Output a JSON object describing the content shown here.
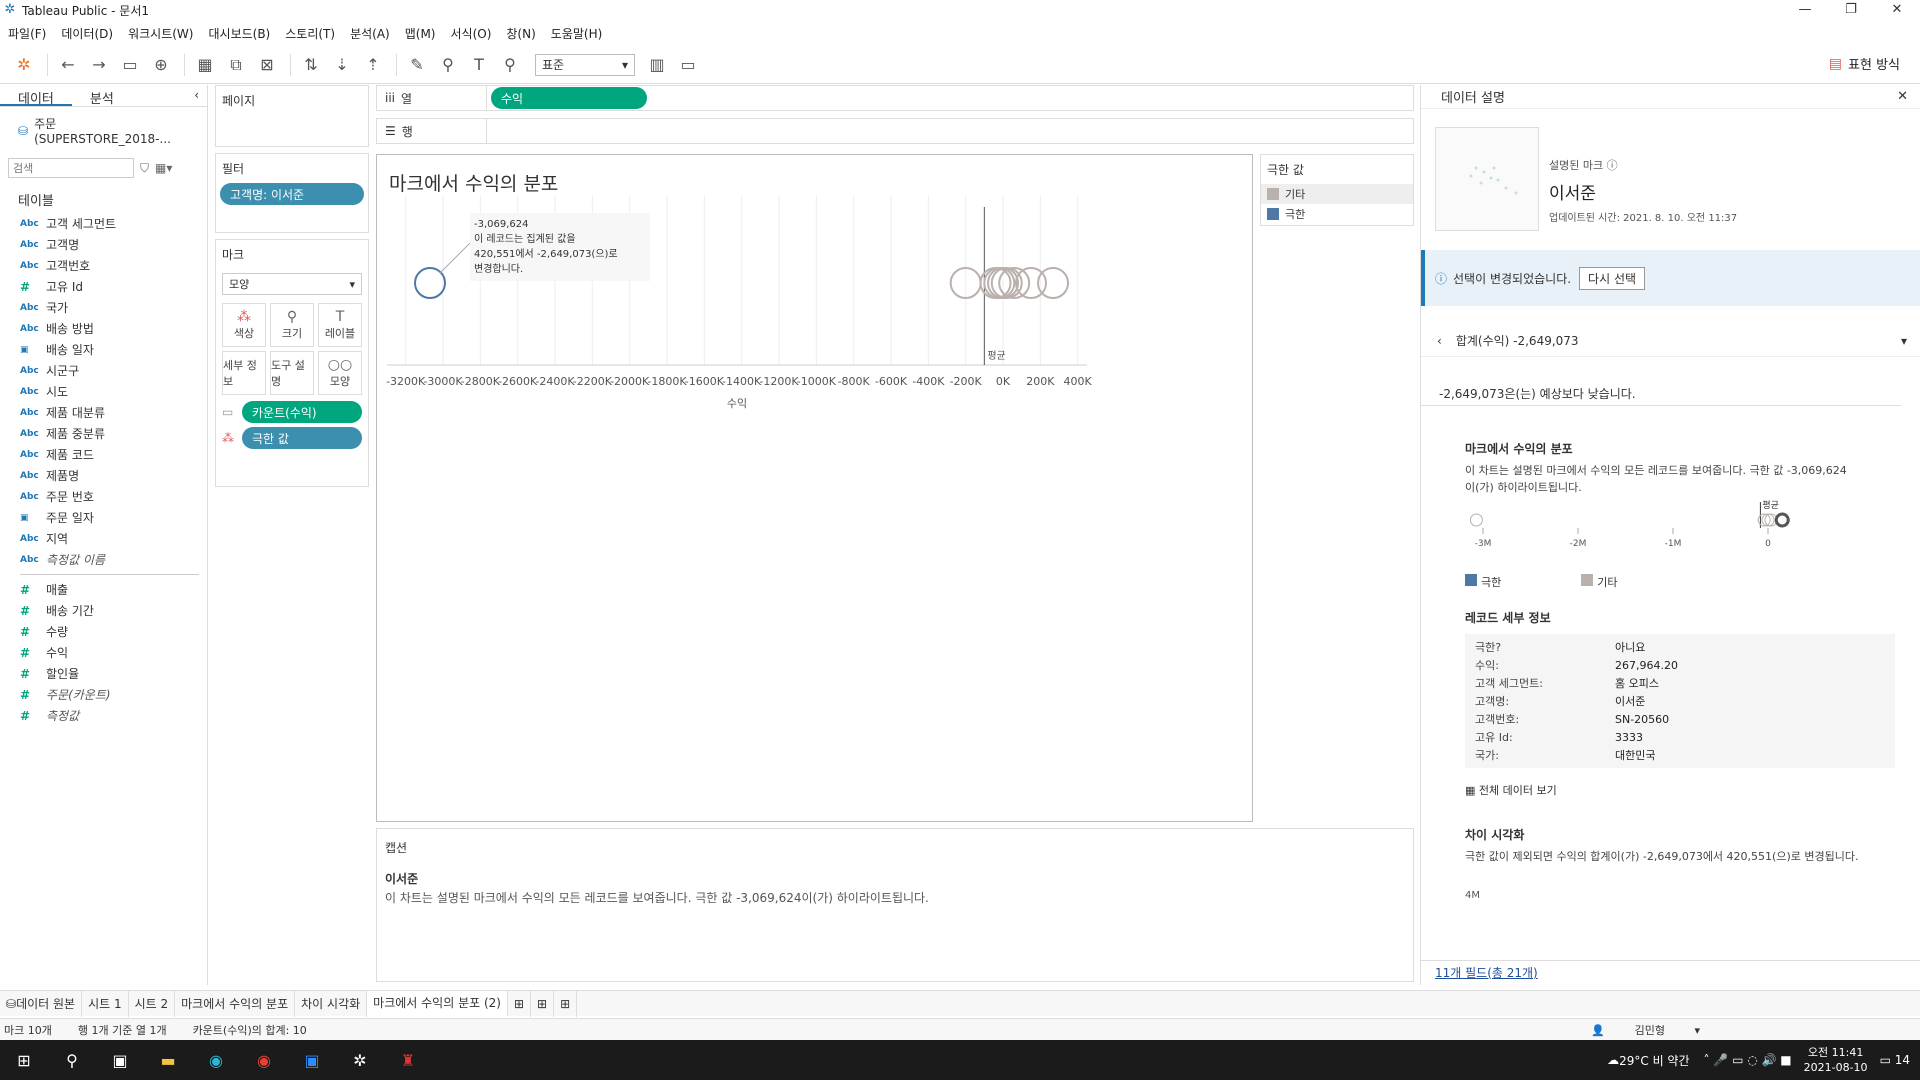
{
  "window": {
    "title": "Tableau Public - 문서1"
  },
  "menu": [
    "파일(F)",
    "데이터(D)",
    "워크시트(W)",
    "대시보드(B)",
    "스토리(T)",
    "분석(A)",
    "맵(M)",
    "서식(O)",
    "창(N)",
    "도움말(H)"
  ],
  "toolbar": {
    "fit_select": "표준",
    "show_me": "표현 방식"
  },
  "data_panel": {
    "tabs": [
      "데이터",
      "분석"
    ],
    "source": "주문(SUPERSTORE_2018-...",
    "search_placeholder": "검색",
    "tables_label": "테이블",
    "dimensions": [
      {
        "type": "Abc",
        "name": "고객 세그먼트"
      },
      {
        "type": "Abc",
        "name": "고객명"
      },
      {
        "type": "Abc",
        "name": "고객번호"
      },
      {
        "type": "#",
        "name": "고유 Id"
      },
      {
        "type": "Abc",
        "name": "국가"
      },
      {
        "type": "Abc",
        "name": "배송 방법"
      },
      {
        "type": "cal",
        "name": "배송 일자"
      },
      {
        "type": "Abc",
        "name": "시군구"
      },
      {
        "type": "Abc",
        "name": "시도"
      },
      {
        "type": "Abc",
        "name": "제품 대분류"
      },
      {
        "type": "Abc",
        "name": "제품 중분류"
      },
      {
        "type": "Abc",
        "name": "제품 코드"
      },
      {
        "type": "Abc",
        "name": "제품명"
      },
      {
        "type": "Abc",
        "name": "주문 번호"
      },
      {
        "type": "cal",
        "name": "주문 일자"
      },
      {
        "type": "Abc",
        "name": "지역"
      },
      {
        "type": "Abc",
        "name": "측정값 이름"
      }
    ],
    "measures": [
      {
        "type": "#",
        "name": "매출"
      },
      {
        "type": "#",
        "name": "배송 기간"
      },
      {
        "type": "#",
        "name": "수량"
      },
      {
        "type": "#",
        "name": "수익"
      },
      {
        "type": "#",
        "name": "할인율"
      },
      {
        "type": "#",
        "name": "주문(카운트)"
      },
      {
        "type": "#",
        "name": "측정값"
      }
    ]
  },
  "cards": {
    "pages": "페이지",
    "filters": "필터",
    "filter_pill": "고객명: 이서준",
    "marks": "마크",
    "mark_type": "모양",
    "mark_buttons": [
      [
        "색상",
        "크기",
        "레이블"
      ],
      [
        "세부 정보",
        "도구 설명",
        "모양"
      ]
    ],
    "tooltip_pill": "카운트(수익)",
    "color_pill": "극한 값"
  },
  "shelves": {
    "columns_label": "열",
    "rows_label": "행",
    "columns_pill": "수익"
  },
  "view": {
    "title": "마크에서 수익의 분포",
    "annotation": [
      "-3,069,624",
      "이 레코드는 집계된 값을",
      "420,551에서 -2,649,073(으)로",
      "변경합니다."
    ],
    "avg_label": "평균",
    "axis_title": "수익",
    "ticks": [
      "-3200K",
      "-3000K",
      "-2800K",
      "-2600K",
      "-2400K",
      "-2200K",
      "-2000K",
      "-1800K",
      "-1600K",
      "-1400K",
      "-1200K",
      "-1000K",
      "-800K",
      "-600K",
      "-400K",
      "-200K",
      "0K",
      "200K",
      "400K"
    ]
  },
  "chart_data": {
    "type": "scatter",
    "title": "마크에서 수익의 분포",
    "xlabel": "수익",
    "xlim": [
      -3300000,
      450000
    ],
    "series": [
      {
        "name": "극한",
        "values": [
          -3069624
        ]
      },
      {
        "name": "기타",
        "values": [
          -200000,
          -40000,
          -20000,
          0,
          20000,
          60000,
          150000,
          267964
        ]
      }
    ],
    "average": -100000,
    "colors": {
      "극한": "#4e79a7",
      "기타": "#bab0ac"
    }
  },
  "legend": {
    "title": "극한 값",
    "items": [
      {
        "label": "기타",
        "color": "#bab0ac"
      },
      {
        "label": "극한",
        "color": "#4e79a7"
      }
    ]
  },
  "caption": {
    "title": "캡션",
    "name": "이서준",
    "text": "이 차트는 설명된 마크에서 수익의 모든 레코드를 보여줍니다. 극한 값 -3,069,624이(가) 하이라이트됩니다."
  },
  "explain": {
    "header": "데이터 설명",
    "mark_label": "설명된 마크",
    "mark_name": "이서준",
    "updated": "업데이트된 시간: 2021. 8. 10. 오전 11:37",
    "notice": "선택이 변경되었습니다.",
    "reselect": "다시 선택",
    "summary": "합계(수익)  -2,649,073",
    "expectation": "-2,649,073은(는) 예상보다 낮습니다.",
    "dist_title": "마크에서 수익의 분포",
    "dist_text": "이 차트는 설명된 마크에서 수익의 모든 레코드를 보여줍니다. 극한 값 -3,069,624이(가) 하이라이트됩니다.",
    "mini_ticks": [
      "-3M",
      "-2M",
      "-1M",
      "0"
    ],
    "mini_avg": "평균",
    "mini_legend": [
      "극한",
      "기타"
    ],
    "record_title": "레코드 세부 정보",
    "records": [
      {
        "k": "극한?",
        "v": "아니요"
      },
      {
        "k": "수익:",
        "v": "267,964.20"
      },
      {
        "k": "고객 세그먼트:",
        "v": "홈 오피스"
      },
      {
        "k": "고객명:",
        "v": "이서준"
      },
      {
        "k": "고객번호:",
        "v": "SN-20560"
      },
      {
        "k": "고유 Id:",
        "v": "3333"
      },
      {
        "k": "국가:",
        "v": "대한민국"
      }
    ],
    "view_all": "전체 데이터 보기",
    "diff_title": "차이 시각화",
    "diff_text": "극한 값이 제외되면 수익의 합계이(가) -2,649,073에서 420,551(으)로 변경됩니다.",
    "diff_tick": "4M",
    "fields_link": "11개 필드(총 21개)"
  },
  "sheets": [
    "데이터 원본",
    "시트 1",
    "시트 2",
    "마크에서 수익의 분포",
    "차이 시각화",
    "마크에서 수익의 분포 (2)"
  ],
  "status": {
    "marks": "마크 10개",
    "rows": "행 1개 기준 열 1개",
    "sum": "카운트(수익)의 합계: 10",
    "user": "김민형"
  },
  "taskbar": {
    "weather": "29°C 비 약간",
    "time": "오전 11:41",
    "date": "2021-08-10",
    "notif": "14"
  }
}
